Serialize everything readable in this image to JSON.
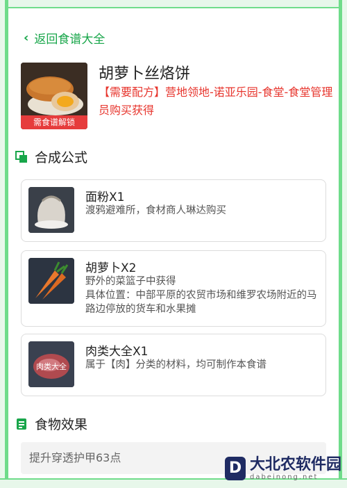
{
  "nav": {
    "back_label": "返回食谱大全"
  },
  "recipe": {
    "title": "胡萝卜丝烙饼",
    "source": "【需要配方】营地领地-诺亚乐园-食堂-食堂管理员购买获得",
    "thumb_badge": "需食谱解锁"
  },
  "sections": {
    "formula_title": "合成公式",
    "effect_title": "食物效果"
  },
  "ingredients": [
    {
      "name": "面粉X1",
      "desc": "渡鸦避难所，食材商人琳达购买"
    },
    {
      "name": "胡萝卜X2",
      "desc": "野外的菜篮子中获得\n具体位置：中部平原的农贸市场和维罗农场附近的马路边停放的货车和水果摊"
    },
    {
      "name": "肉类大全X1",
      "desc": "属于【肉】分类的材料，均可制作本食谱",
      "thumb_label": "肉类大全"
    }
  ],
  "effect": {
    "text": "提升穿透护甲63点"
  },
  "watermark": {
    "logo": "D",
    "cn": "大北农软件园",
    "en": "dabeinong.net"
  },
  "colors": {
    "accent": "#18a64a",
    "frame": "#6fdc8a",
    "warning": "#e7342c"
  }
}
